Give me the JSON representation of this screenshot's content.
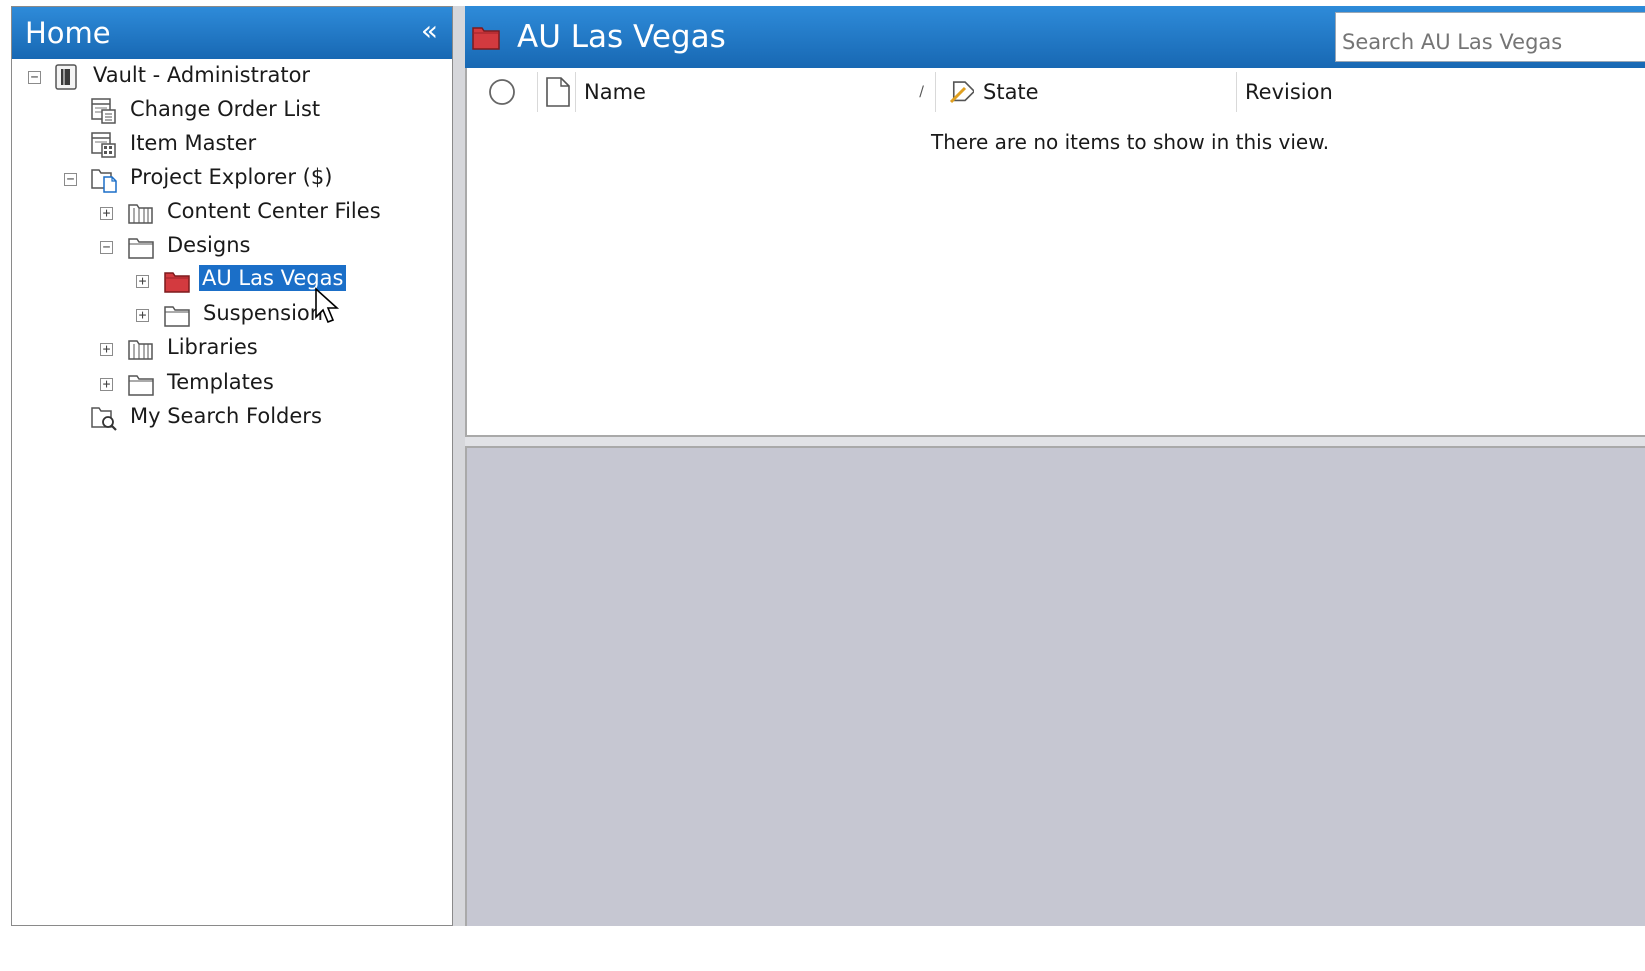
{
  "nav": {
    "title": "Home",
    "collapse_glyph": "«",
    "tree": [
      {
        "label": "Vault - Administrator",
        "icon": "vault-icon",
        "expander": "−"
      },
      {
        "label": "Change Order List",
        "icon": "change-order-list-icon"
      },
      {
        "label": "Item Master",
        "icon": "item-master-icon"
      },
      {
        "label": "Project Explorer ($)",
        "icon": "project-explorer-icon",
        "expander": "−"
      },
      {
        "label": "Content Center Files",
        "icon": "library-folder-icon",
        "expander": "+"
      },
      {
        "label": "Designs",
        "icon": "folder-icon",
        "expander": "−"
      },
      {
        "label": "AU Las Vegas",
        "icon": "red-folder-icon",
        "expander": "+",
        "selected": true
      },
      {
        "label": "Suspension",
        "icon": "folder-icon",
        "expander": "+"
      },
      {
        "label": "Libraries",
        "icon": "library-folder-icon",
        "expander": "+"
      },
      {
        "label": "Templates",
        "icon": "folder-icon",
        "expander": "+"
      },
      {
        "label": "My Search Folders",
        "icon": "search-folder-icon"
      }
    ]
  },
  "content": {
    "title": "AU Las Vegas",
    "search_placeholder": "Search AU Las Vegas",
    "columns": {
      "name": "Name",
      "sort_glyph": "/",
      "state": "State",
      "revision": "Revision"
    },
    "empty_message": "There are no items to show in this view."
  },
  "colors": {
    "header_blue": "#1b6fc8",
    "selection_blue": "#1b6fc8",
    "folder_red": "#d33a3f",
    "preview_gray": "#c6c7d2"
  }
}
